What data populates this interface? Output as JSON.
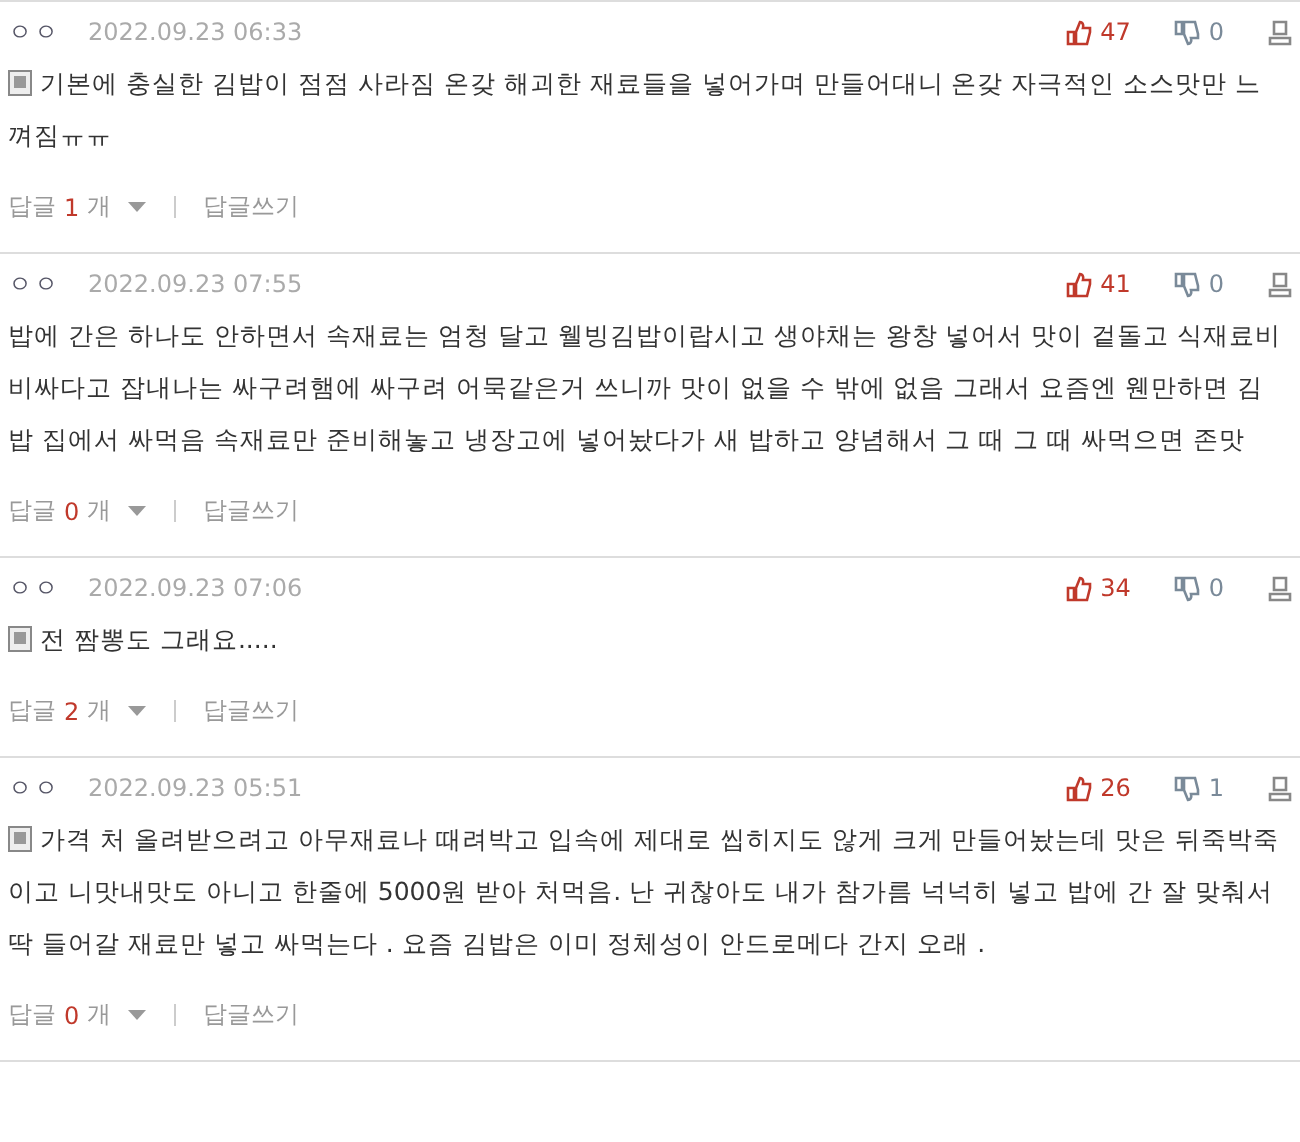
{
  "comments": [
    {
      "author": "ㅇㅇ",
      "date": "2022.09.23 06:33",
      "likes": "47",
      "dislikes": "0",
      "memo_icon": true,
      "text": "기본에 충실한 김밥이 점점 사라짐 온갖 해괴한 재료들을 넣어가며 만들어대니 온갖 자극적인 소스맛만 느껴짐ㅠㅠ",
      "reply_label": "답글",
      "reply_count": "1",
      "reply_unit": "개",
      "write_reply": "답글쓰기"
    },
    {
      "author": "ㅇㅇ",
      "date": "2022.09.23 07:55",
      "likes": "41",
      "dislikes": "0",
      "memo_icon": false,
      "text": "밥에 간은 하나도 안하면서 속재료는 엄청 달고 웰빙김밥이랍시고 생야채는 왕창 넣어서 맛이 겉돌고 식재료비 비싸다고 잡내나는 싸구려햄에 싸구려 어묵같은거 쓰니까 맛이 없을 수 밖에 없음 그래서 요즘엔 웬만하면 김밥 집에서 싸먹음 속재료만 준비해놓고 냉장고에 넣어놨다가 새 밥하고 양념해서 그 때 그 때 싸먹으면 존맛",
      "reply_label": "답글",
      "reply_count": "0",
      "reply_unit": "개",
      "write_reply": "답글쓰기"
    },
    {
      "author": "ㅇㅇ",
      "date": "2022.09.23 07:06",
      "likes": "34",
      "dislikes": "0",
      "memo_icon": true,
      "text": "전 짬뽕도 그래요.....",
      "reply_label": "답글",
      "reply_count": "2",
      "reply_unit": "개",
      "write_reply": "답글쓰기"
    },
    {
      "author": "ㅇㅇ",
      "date": "2022.09.23 05:51",
      "likes": "26",
      "dislikes": "1",
      "memo_icon": true,
      "text": "가격 처 올려받으려고 아무재료나 때려박고 입속에 제대로 씹히지도 않게 크게 만들어놨는데 맛은 뒤죽박죽이고 니맛내맛도 아니고 한줄에 5000원 받아 처먹음. 난 귀찮아도 내가 참가름 넉넉히 넣고 밥에 간 잘 맞춰서 딱 들어갈 재료만 넣고 싸먹는다 . 요즘 김밥은 이미 정체성이 안드로메다 간지 오래 .",
      "reply_label": "답글",
      "reply_count": "0",
      "reply_unit": "개",
      "write_reply": "답글쓰기"
    }
  ]
}
